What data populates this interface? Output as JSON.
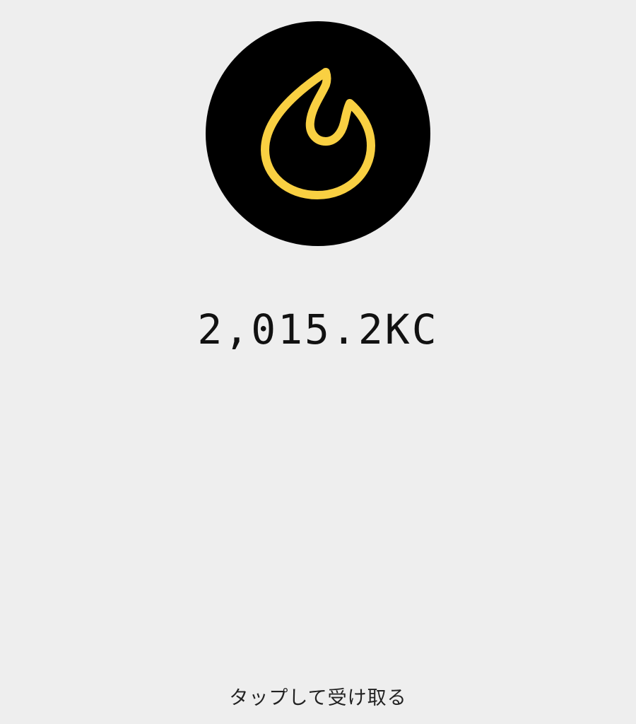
{
  "reward": {
    "icon": "flame-icon",
    "icon_color": "#f9d042",
    "circle_color": "#000000",
    "balance": "2,015.2KC"
  },
  "action": {
    "claim_label": "タップして受け取る"
  }
}
